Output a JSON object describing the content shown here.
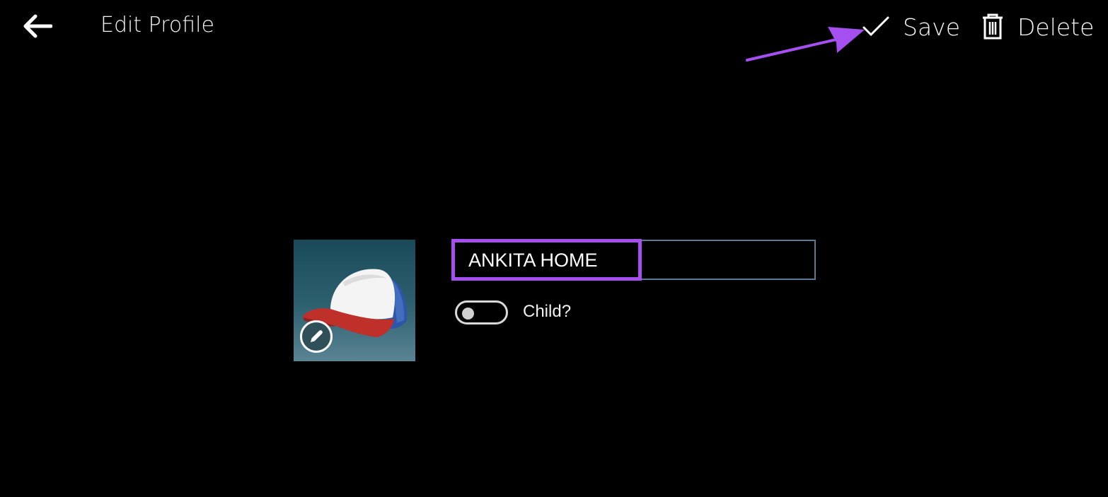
{
  "header": {
    "back_icon": "arrow-left-icon",
    "title": "Edit Profile"
  },
  "commands": {
    "save": {
      "icon": "checkmark-icon",
      "label": "Save"
    },
    "delete": {
      "icon": "trash-icon",
      "label": "Delete"
    }
  },
  "profile": {
    "avatar_description": "trucker cap (white, blue, red)",
    "edit_avatar_icon": "pencil-icon",
    "name_value": "ANKITA HOME",
    "child_toggle": {
      "label": "Child?",
      "checked": false
    }
  },
  "annotation": {
    "arrow_color": "#a64ff0",
    "highlight_color": "#a64ff0"
  },
  "colors": {
    "background": "#000000",
    "field_border": "#5f7896",
    "text": "#ffffff"
  }
}
